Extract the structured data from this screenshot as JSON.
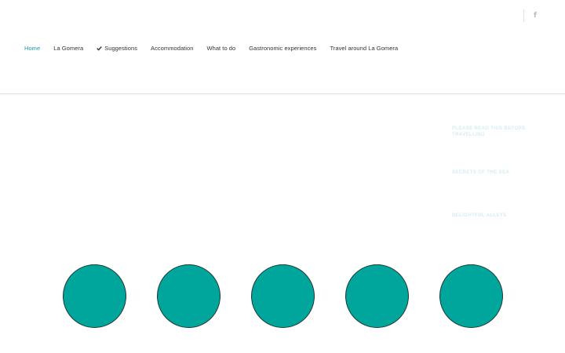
{
  "header": {
    "social": {
      "facebook_glyph": "f",
      "facebook_icon": "facebook-icon"
    },
    "nav": {
      "items": [
        {
          "label": "Home",
          "active": true
        },
        {
          "label": "La Gomera",
          "active": false
        },
        {
          "label": "Suggestions",
          "active": false,
          "icon": "check-icon"
        },
        {
          "label": "Accommodation",
          "active": false
        },
        {
          "label": "What to do",
          "active": false
        },
        {
          "label": "Gastronomic experiences",
          "active": false
        },
        {
          "label": "Travel around La Gomera",
          "active": false
        }
      ]
    }
  },
  "sidebar": {
    "links": [
      {
        "label": "PLEASE READ THIS BEFORE TRAVELLING"
      },
      {
        "label": "SECRETS OF THE SEA"
      },
      {
        "label": "DELIGHTFUL ALLEYS"
      }
    ]
  },
  "circles": {
    "count": 5,
    "fill_color": "#00a69b",
    "border_color": "#1d3a37"
  },
  "colors": {
    "accent": "#1a9aa5",
    "nav_text": "#333333",
    "side_link_text": "#d4ecf3",
    "icon_grey": "#b9b9b9"
  }
}
